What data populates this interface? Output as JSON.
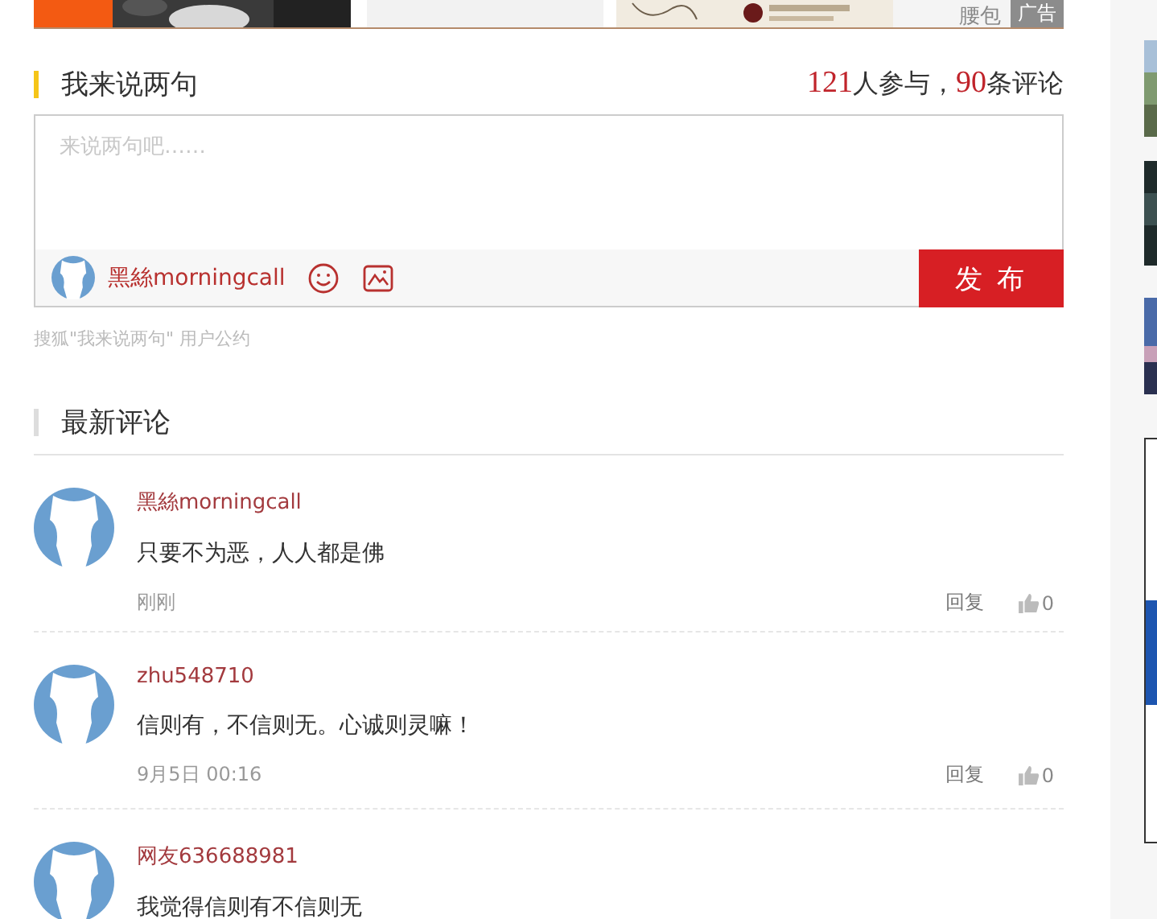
{
  "ad_strip": {
    "caption": "腰包",
    "badge": "广告"
  },
  "comment_form": {
    "title": "我来说两句",
    "participants": "121",
    "participants_label": "人参与，",
    "comment_count": "90",
    "comment_count_label": "条评论",
    "placeholder": "来说两句吧……",
    "username": "黑絲morningcall",
    "submit": "发 布",
    "terms": "搜狐\"我来说两句\" 用户公约"
  },
  "latest": {
    "title": "最新评论",
    "comments": [
      {
        "name": "黑絲morningcall",
        "text": "只要不为恶，人人都是佛",
        "time": "刚刚",
        "reply": "回复",
        "likes": "0"
      },
      {
        "name": "zhu548710",
        "text": "信则有，不信则无。心诚则灵嘛！",
        "time": "9月5日 00:16",
        "reply": "回复",
        "likes": "0"
      },
      {
        "name": "网友636688981",
        "text": "我觉得信则有不信则无"
      }
    ]
  }
}
